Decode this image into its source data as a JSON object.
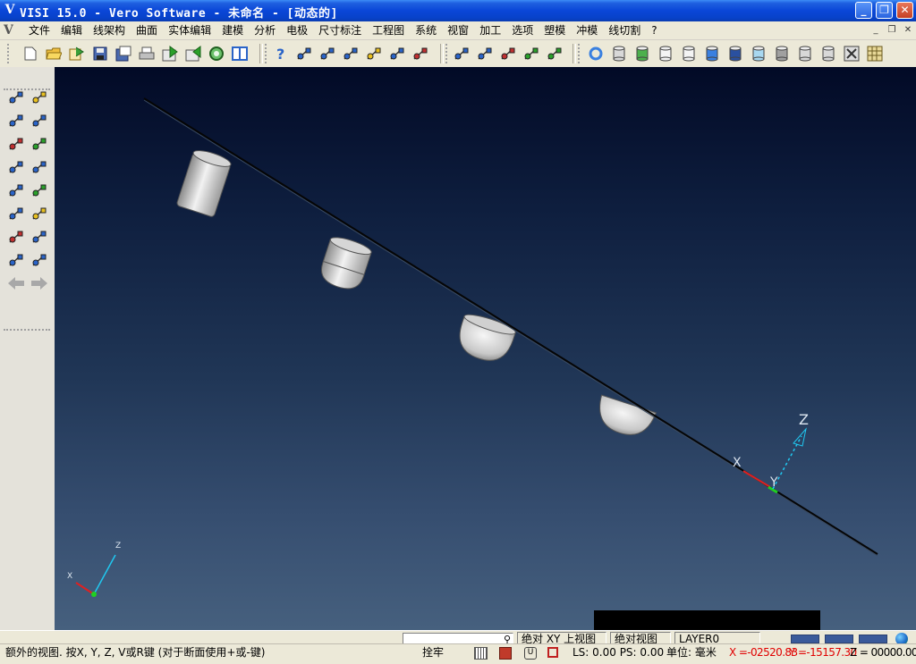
{
  "window": {
    "title": "VISI 15.0 - Vero Software  - 未命名 - [动态的]",
    "logo": "V",
    "minimize": "_",
    "restore": "❐",
    "close": "✕"
  },
  "menu": {
    "logo": "V",
    "items": [
      "文件",
      "编辑",
      "线架构",
      "曲面",
      "实体编辑",
      "建模",
      "分析",
      "电极",
      "尺寸标注",
      "工程图",
      "系统",
      "视窗",
      "加工",
      "选项",
      "塑模",
      "冲模",
      "线切割",
      "?"
    ],
    "mdi_min": "_",
    "mdi_restore": "❐",
    "mdi_close": "✕"
  },
  "toolbar": {
    "icons": [
      "new-file-icon",
      "open-folder-icon",
      "open-icon",
      "save-icon",
      "save-as-icon",
      "print-icon",
      "import-icon",
      "export-icon",
      "zoom-icon",
      "split-view-icon",
      "help-icon",
      "query-icon",
      "query-point-icon",
      "query-entity-icon",
      "query-angle-icon",
      "query-curve-icon",
      "query-dims-icon",
      "transform-icon",
      "move-icon",
      "rotate-icon",
      "shade-icon",
      "solid-icon",
      "refresh-icon",
      "cylinder-icon",
      "cylinder-green-icon",
      "cylinder-white-icon",
      "cylinder-outline-icon",
      "cylinder-blue-icon",
      "cylinder-darkblue-icon",
      "cylinder-light-icon",
      "cylinder-gray-icon",
      "cylinder-mesh-icon",
      "cylinder-dual-icon",
      "box-cross-icon",
      "grid-icon"
    ]
  },
  "left_toolbar": {
    "icons": [
      "zoom-window-icon",
      "measure-icon",
      "fit-icon",
      "edit-curve-icon",
      "rotate-view-icon",
      "layer-icon",
      "pan-icon",
      "curve-edit-icon",
      "refresh-view-icon",
      "solid-box-icon",
      "help-query-icon",
      "dimension-icon",
      "delete-icon",
      "undo-icon",
      "attributes-icon",
      "screenshot-icon",
      "arrow-left-icon",
      "arrow-right-icon"
    ]
  },
  "viewport": {
    "axis_labels": {
      "x": "X",
      "y": "Y",
      "z": "Z"
    },
    "triad_labels": {
      "x": "X",
      "z": "Z"
    },
    "colors": {
      "x_axis": "#E02020",
      "y_axis": "#20D020",
      "z_axis": "#20C8F0",
      "line": "#050505"
    }
  },
  "status": {
    "hint": "额外的视图. 按X, Y, Z, V或R键 (对于断面使用+或-键)",
    "search_value": "",
    "view_name": "绝对 XY 上视图",
    "absolute_view": "绝对视图",
    "layer": "LAYER0",
    "snap": "拴牢",
    "ls_ps": "LS: 0.00 PS: 0.00",
    "unit": "单位: 毫米",
    "coords_x": "X =-02520.83",
    "coords_y": "Y =-15157.30",
    "coords_z": "Z = 00000.00"
  }
}
